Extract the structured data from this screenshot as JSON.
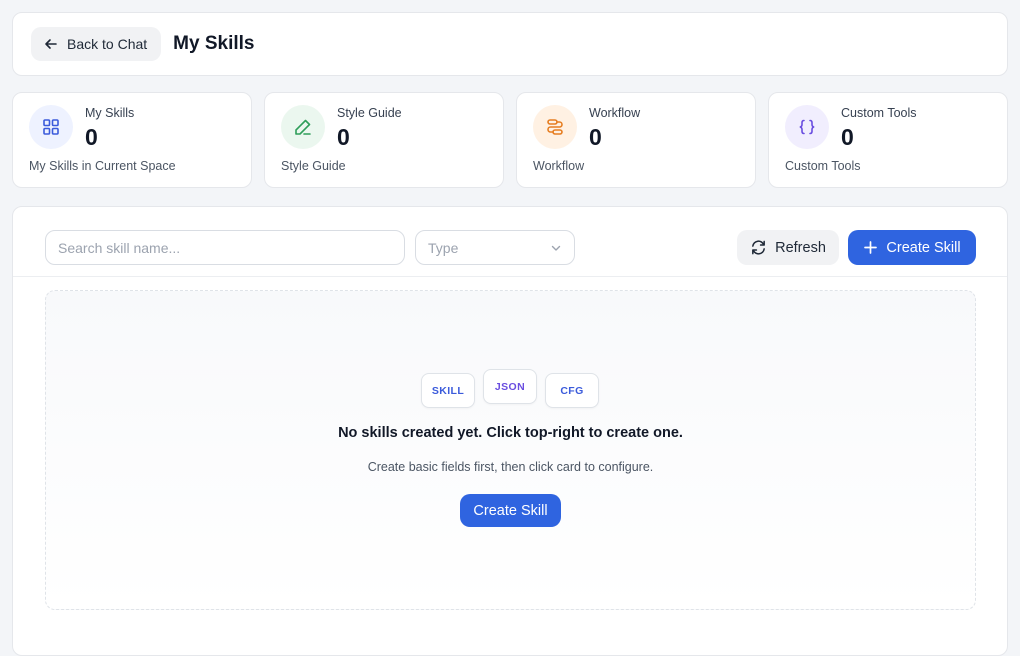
{
  "header": {
    "back_label": "Back to Chat",
    "title": "My Skills"
  },
  "stats": [
    {
      "label": "My Skills",
      "value": "0",
      "sub": "My Skills in Current Space",
      "icon": "grid-icon",
      "color": "#3b5bdb",
      "bg": "#eef2ff"
    },
    {
      "label": "Style Guide",
      "value": "0",
      "sub": "Style Guide",
      "icon": "pencil-icon",
      "color": "#2f9e5a",
      "bg": "#ebf7ef"
    },
    {
      "label": "Workflow",
      "value": "0",
      "sub": "Workflow",
      "icon": "workflow-icon",
      "color": "#e67e22",
      "bg": "#fff1e3"
    },
    {
      "label": "Custom Tools",
      "value": "0",
      "sub": "Custom Tools",
      "icon": "braces-icon",
      "color": "#6a4ee0",
      "bg": "#f1eefe"
    }
  ],
  "toolbar": {
    "search_placeholder": "Search skill name...",
    "type_placeholder": "Type",
    "refresh_label": "Refresh",
    "create_label": "Create Skill"
  },
  "empty": {
    "chips": [
      {
        "label": "SKILL",
        "color": "#3b5bdb"
      },
      {
        "label": "JSON",
        "color": "#6a4ee0"
      },
      {
        "label": "CFG",
        "color": "#3b5bdb"
      }
    ],
    "title": "No skills created yet. Click top-right to create one.",
    "subtitle": "Create basic fields first, then click card to configure.",
    "create_label": "Create Skill"
  },
  "colors": {
    "primary": "#2f64e0",
    "border": "#e5e7eb"
  }
}
